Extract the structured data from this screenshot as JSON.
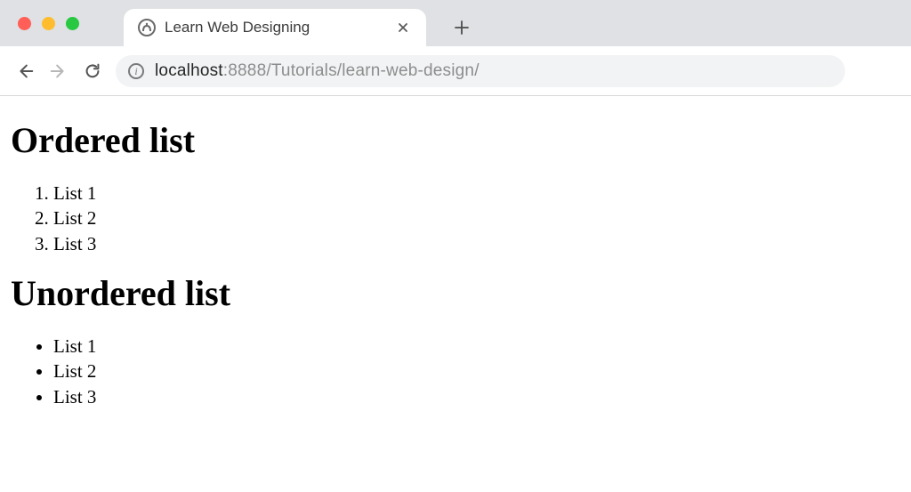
{
  "window": {
    "tab_title": "Learn Web Designing"
  },
  "address": {
    "host": "localhost",
    "port": ":8888",
    "path": "/Tutorials/learn-web-design/"
  },
  "page": {
    "heading_ordered": "Ordered list",
    "heading_unordered": "Unordered list",
    "ordered_items": [
      "List 1",
      "List 2",
      "List 3"
    ],
    "unordered_items": [
      "List 1",
      "List 2",
      "List 3"
    ]
  }
}
